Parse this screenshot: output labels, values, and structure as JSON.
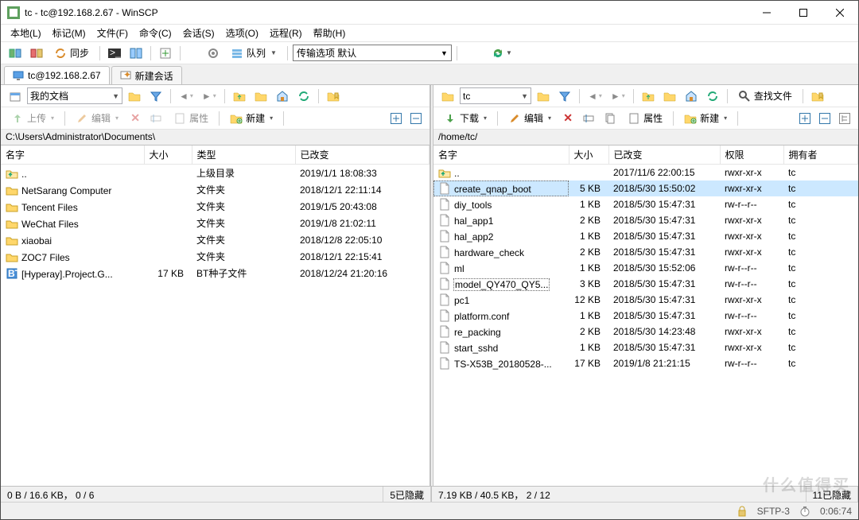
{
  "window": {
    "title": "tc - tc@192.168.2.67 - WinSCP"
  },
  "menu": {
    "local": "本地(L)",
    "mark": "标记(M)",
    "file": "文件(F)",
    "command": "命令(C)",
    "session": "会话(S)",
    "options": "选项(O)",
    "remote": "远程(R)",
    "help": "帮助(H)"
  },
  "toolbar": {
    "sync_label": "同步",
    "queue_label": "队列",
    "transfer_label": "传输选项 默认"
  },
  "tabs": {
    "active": "tc@192.168.2.67",
    "new": "新建会话"
  },
  "left": {
    "drive_label": "我的文档",
    "upload_label": "上传",
    "edit_label": "编辑",
    "props_label": "属性",
    "new_label": "新建",
    "path": "C:\\Users\\Administrator\\Documents\\",
    "cols": {
      "name": "名字",
      "size": "大小",
      "type": "类型",
      "changed": "已改变"
    },
    "rows": [
      {
        "icon": "up",
        "name": "..",
        "size": "",
        "type": "上级目录",
        "changed": "2019/1/1  18:08:33"
      },
      {
        "icon": "folder",
        "name": "NetSarang Computer",
        "size": "",
        "type": "文件夹",
        "changed": "2018/12/1  22:11:14"
      },
      {
        "icon": "folder",
        "name": "Tencent Files",
        "size": "",
        "type": "文件夹",
        "changed": "2019/1/5  20:43:08"
      },
      {
        "icon": "folder",
        "name": "WeChat Files",
        "size": "",
        "type": "文件夹",
        "changed": "2019/1/8  21:02:11"
      },
      {
        "icon": "folder",
        "name": "xiaobai",
        "size": "",
        "type": "文件夹",
        "changed": "2018/12/8  22:05:10"
      },
      {
        "icon": "folder",
        "name": "ZOC7 Files",
        "size": "",
        "type": "文件夹",
        "changed": "2018/12/1  22:15:41"
      },
      {
        "icon": "torrent",
        "name": "[Hyperay].Project.G...",
        "size": "17 KB",
        "type": "BT种子文件",
        "changed": "2018/12/24  21:20:16"
      }
    ],
    "status_left": "0 B / 16.6 KB， 0 / 6",
    "status_right": "5已隐藏"
  },
  "right": {
    "drive_label": "tc",
    "find_label": "查找文件",
    "download_label": "下载",
    "edit_label": "编辑",
    "props_label": "属性",
    "new_label": "新建",
    "path": "/home/tc/",
    "cols": {
      "name": "名字",
      "size": "大小",
      "changed": "已改变",
      "rights": "权限",
      "owner": "拥有者"
    },
    "rows": [
      {
        "icon": "up",
        "name": "..",
        "size": "",
        "changed": "2017/11/6 22:00:15",
        "rights": "rwxr-xr-x",
        "owner": "tc",
        "selected": false
      },
      {
        "icon": "file",
        "name": "create_qnap_boot",
        "size": "5 KB",
        "changed": "2018/5/30 15:50:02",
        "rights": "rwxr-xr-x",
        "owner": "tc",
        "selected": true
      },
      {
        "icon": "file",
        "name": "diy_tools",
        "size": "1 KB",
        "changed": "2018/5/30 15:47:31",
        "rights": "rw-r--r--",
        "owner": "tc"
      },
      {
        "icon": "file",
        "name": "hal_app1",
        "size": "2 KB",
        "changed": "2018/5/30 15:47:31",
        "rights": "rwxr-xr-x",
        "owner": "tc"
      },
      {
        "icon": "file",
        "name": "hal_app2",
        "size": "1 KB",
        "changed": "2018/5/30 15:47:31",
        "rights": "rwxr-xr-x",
        "owner": "tc"
      },
      {
        "icon": "file",
        "name": "hardware_check",
        "size": "2 KB",
        "changed": "2018/5/30 15:47:31",
        "rights": "rwxr-xr-x",
        "owner": "tc"
      },
      {
        "icon": "file",
        "name": "ml",
        "size": "1 KB",
        "changed": "2018/5/30 15:52:06",
        "rights": "rw-r--r--",
        "owner": "tc"
      },
      {
        "icon": "file",
        "name": "model_QY470_QY5...",
        "size": "3 KB",
        "changed": "2018/5/30 15:47:31",
        "rights": "rw-r--r--",
        "owner": "tc",
        "focused": true
      },
      {
        "icon": "file",
        "name": "pc1",
        "size": "12 KB",
        "changed": "2018/5/30 15:47:31",
        "rights": "rwxr-xr-x",
        "owner": "tc"
      },
      {
        "icon": "file",
        "name": "platform.conf",
        "size": "1 KB",
        "changed": "2018/5/30 15:47:31",
        "rights": "rw-r--r--",
        "owner": "tc"
      },
      {
        "icon": "file",
        "name": "re_packing",
        "size": "2 KB",
        "changed": "2018/5/30 14:23:48",
        "rights": "rwxr-xr-x",
        "owner": "tc"
      },
      {
        "icon": "file",
        "name": "start_sshd",
        "size": "1 KB",
        "changed": "2018/5/30 15:47:31",
        "rights": "rwxr-xr-x",
        "owner": "tc"
      },
      {
        "icon": "file",
        "name": "TS-X53B_20180528-...",
        "size": "17 KB",
        "changed": "2019/1/8 21:21:15",
        "rights": "rw-r--r--",
        "owner": "tc"
      }
    ],
    "status_left": "7.19 KB / 40.5 KB， 2 / 12",
    "status_right": "11已隐藏"
  },
  "status": {
    "proto": "SFTP-3",
    "time": "0:06:74"
  },
  "watermark": "什么值得买"
}
